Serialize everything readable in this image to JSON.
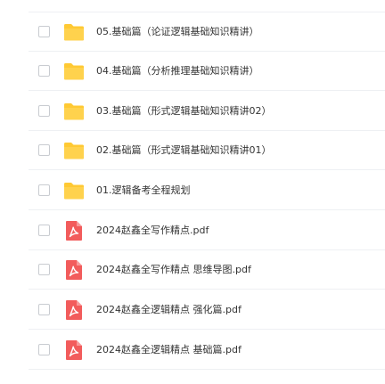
{
  "files": [
    {
      "name": "05.基础篇（论证逻辑基础知识精讲）",
      "type": "folder"
    },
    {
      "name": "04.基础篇（分析推理基础知识精讲）",
      "type": "folder"
    },
    {
      "name": "03.基础篇（形式逻辑基础知识精讲02）",
      "type": "folder"
    },
    {
      "name": "02.基础篇（形式逻辑基础知识精讲01）",
      "type": "folder"
    },
    {
      "name": "01.逻辑备考全程规划",
      "type": "folder"
    },
    {
      "name": "2024赵鑫全写作精点.pdf",
      "type": "pdf"
    },
    {
      "name": "2024赵鑫全写作精点 思维导图.pdf",
      "type": "pdf"
    },
    {
      "name": "2024赵鑫全逻辑精点 强化篇.pdf",
      "type": "pdf"
    },
    {
      "name": "2024赵鑫全逻辑精点 基础篇.pdf",
      "type": "pdf"
    }
  ],
  "colors": {
    "folder": "#ffc933",
    "pdf": "#f25c5c",
    "text": "#333333"
  },
  "icons": {
    "folder": "folder-icon",
    "pdf": "pdf-icon"
  }
}
